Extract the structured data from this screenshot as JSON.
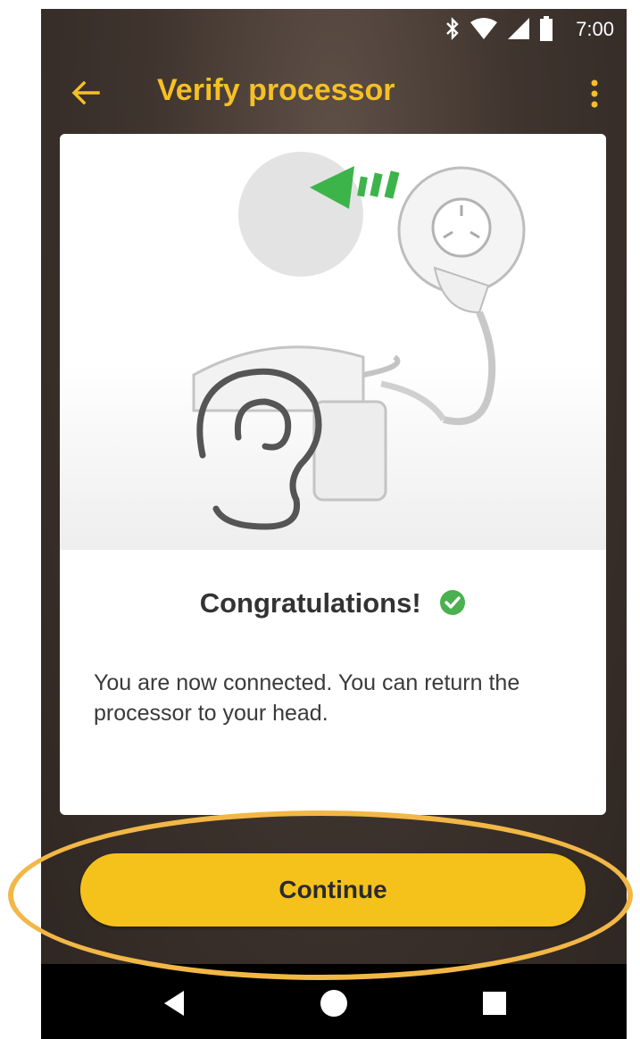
{
  "status_bar": {
    "time": "7:00",
    "icons": [
      "bluetooth-icon",
      "wifi-icon",
      "signal-icon",
      "battery-icon"
    ]
  },
  "app_bar": {
    "title": "Verify processor",
    "back_icon": "arrow-left-icon",
    "menu_icon": "more-vert-icon"
  },
  "card": {
    "heading": "Congratulations!",
    "heading_icon": "check-circle-icon",
    "message": "You are now connected. You can return the processor to your head."
  },
  "actions": {
    "continue_label": "Continue"
  },
  "nav_bar": {
    "icons": [
      "back-triangle-icon",
      "home-circle-icon",
      "recents-square-icon"
    ]
  },
  "colors": {
    "accent": "#f5c21c",
    "title": "#f5c026",
    "check": "#4bb04f",
    "arrow": "#3cb44a",
    "highlight": "#f2b746"
  }
}
